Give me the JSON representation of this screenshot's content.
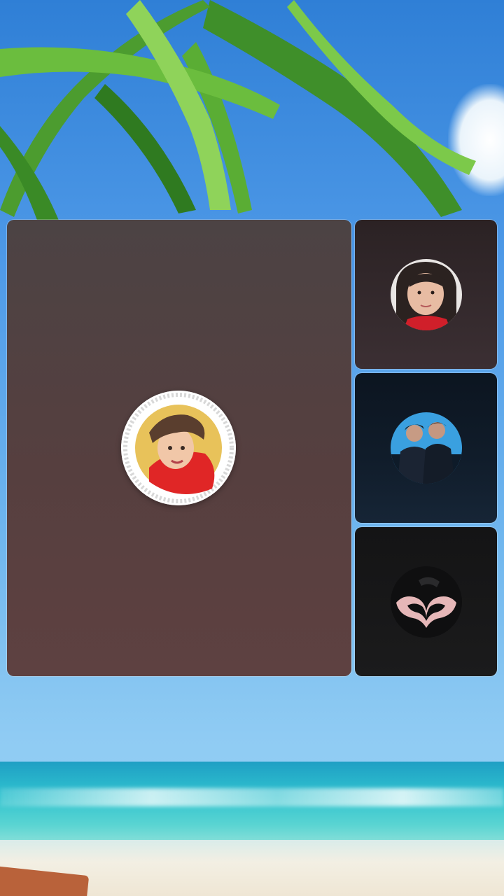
{
  "screen": {
    "type": "group-video-call",
    "background_scene": "tropical-beach"
  },
  "participants": [
    {
      "id": "main",
      "role": "featured-tile",
      "avatar": "profile-photo-red-shirt",
      "camera": "off"
    },
    {
      "id": "p1",
      "role": "side-tile",
      "avatar": "profile-photo-woman-red-top",
      "camera": "off"
    },
    {
      "id": "p2",
      "role": "side-tile",
      "avatar": "profile-photo-two-men",
      "camera": "off"
    },
    {
      "id": "p3",
      "role": "side-tile",
      "avatar": "profile-photo-heart-hands",
      "camera": "off"
    }
  ],
  "colors": {
    "main_tile": "#563f3f",
    "side_tile_1": "#3b2f33",
    "side_tile_2": "#101c2a",
    "side_tile_3": "#1b1b1c"
  }
}
